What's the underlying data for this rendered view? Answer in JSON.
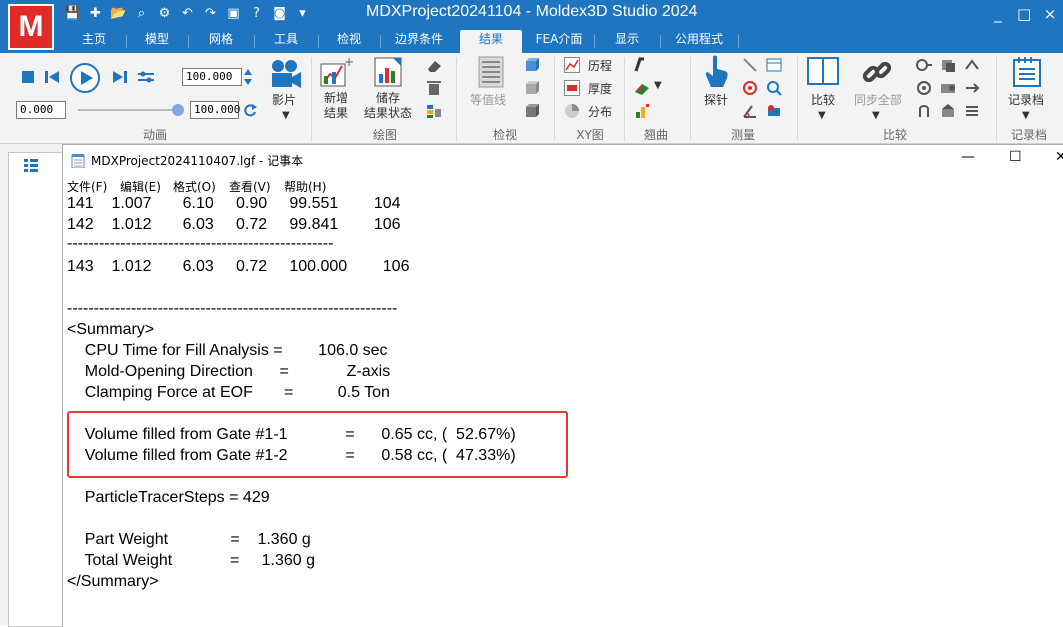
{
  "app": {
    "logo_letter": "M",
    "title": "MDXProject20241104 - Moldex3D Studio 2024",
    "window_controls": [
      "_",
      "□",
      "×"
    ]
  },
  "ribbon_tabs": [
    "主页",
    "模型",
    "网格",
    "工具",
    "检视",
    "边界条件",
    "结果",
    "FEA介面",
    "显示",
    "公用程式"
  ],
  "active_tab": "结果",
  "ribbon": {
    "animation": {
      "speed_value": "100.000",
      "time_value": "0.000",
      "slider_value": "100.000",
      "movie_label": "影片",
      "group_label": "动画"
    },
    "plot": {
      "new_result_label": "新增\n结果",
      "save_state_label": "储存\n结果状态",
      "group_label": "绘图"
    },
    "view": {
      "contour_label": "等值线",
      "group_label": "检视"
    },
    "xy": {
      "history_label": "历程",
      "thickness_label": "厚度",
      "distribution_label": "分布",
      "group_label": "XY图"
    },
    "warpage": {
      "group_label": "翘曲"
    },
    "measure": {
      "probe_label": "探针",
      "group_label": "测量"
    },
    "compare": {
      "compare_label": "比较",
      "sync_all_label": "同步全部",
      "group_label": "比较"
    },
    "log": {
      "log_label": "记录档",
      "group_label": "记录档"
    }
  },
  "notepad": {
    "title": "MDXProject2024110407.lgf - 记事本",
    "menu": [
      "文件(F)",
      "编辑(E)",
      "格式(O)",
      "查看(V)",
      "帮助(H)"
    ],
    "lines": [
      "141    1.007       6.10     0.90     99.551        104",
      "142    1.012       6.03     0.72     99.841        106",
      "--------------------------------------------------",
      "",
      "143    1.012       6.03     0.72     100.000        106",
      "",
      "",
      "--------------------------------------------------------------",
      "<Summary>",
      "    CPU Time for Fill Analysis =        106.0 sec",
      "    Mold-Opening Direction      =             Z-axis",
      "    Clamping Force at EOF       =          0.5 Ton",
      "",
      "    Volume filled from Gate #1-1             =      0.65 cc, (  52.67%)",
      "    Volume filled from Gate #1-2             =      0.58 cc, (  47.33%)",
      "",
      "    ParticleTracerSteps = 429",
      "",
      "    Part Weight              =    1.360 g",
      "    Total Weight             =     1.360 g",
      "</Summary>"
    ]
  },
  "colors": {
    "title_bar": "#1f75bf",
    "logo": "#e02b2b",
    "highlight_box": "#e53935"
  }
}
